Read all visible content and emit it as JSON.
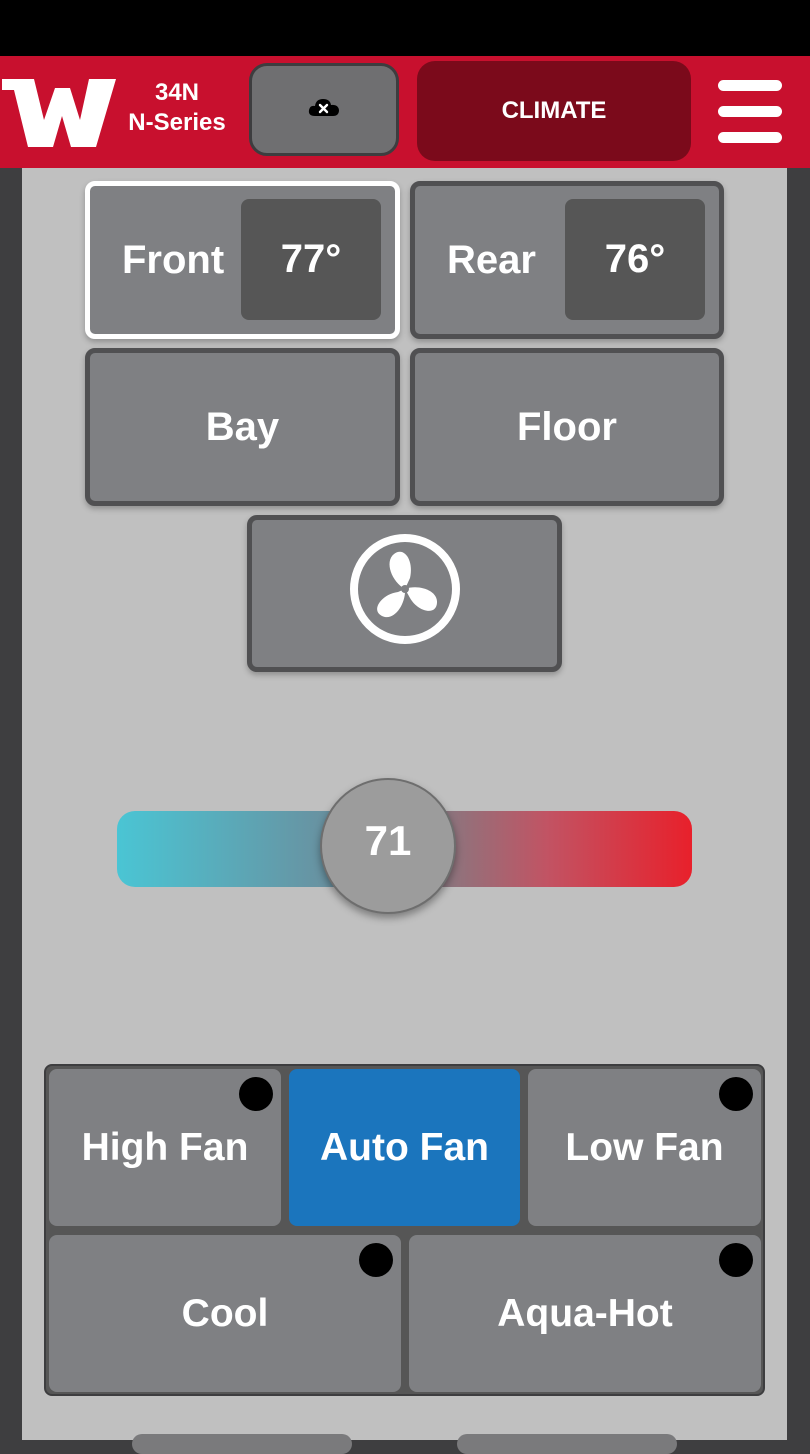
{
  "header": {
    "logo_letter": "W",
    "model_line1": "34N",
    "model_line2": "N-Series",
    "cloud_icon": "cloud-disconnected-icon",
    "climate_label": "CLIMATE",
    "menu_icon": "hamburger-menu-icon"
  },
  "zones": [
    {
      "label": "Front",
      "temp": "77°",
      "selected": true
    },
    {
      "label": "Rear",
      "temp": "76°",
      "selected": false
    }
  ],
  "zone_buttons": {
    "bay": "Bay",
    "floor": "Floor"
  },
  "fan_icon": "fan-icon",
  "thermostat": {
    "value": "71",
    "colors": {
      "cold": "#4ac5d4",
      "hot": "#e8202b"
    }
  },
  "modes": {
    "high_fan": "High Fan",
    "auto_fan": "Auto Fan",
    "low_fan": "Low Fan",
    "cool": "Cool",
    "aqua_hot": "Aqua-Hot",
    "active": "Auto Fan"
  },
  "colors": {
    "brand_red": "#c8102e",
    "climate_active": "#7b0a1b",
    "mode_active": "#1b75bd"
  }
}
